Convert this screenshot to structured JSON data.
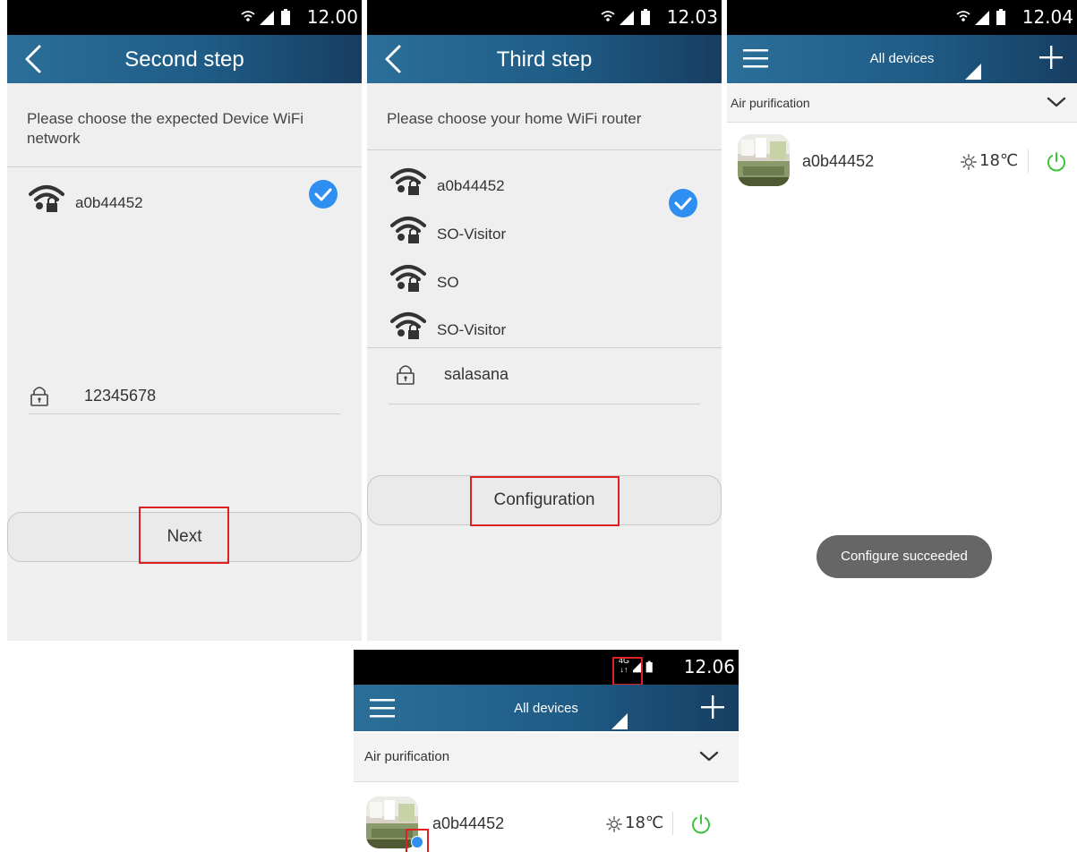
{
  "screens": {
    "second": {
      "status_time": "12.00",
      "title": "Second step",
      "prompt": "Please choose the expected Device WiFi network",
      "networks": [
        {
          "name": "a0b44452",
          "selected": true
        }
      ],
      "password_value": "12345678",
      "next_label": "Next"
    },
    "third": {
      "status_time": "12.03",
      "title": "Third step",
      "prompt": "Please choose your home WiFi router",
      "networks": [
        {
          "name": "a0b44452",
          "selected": false
        },
        {
          "name": "SO-Visitor",
          "selected": true
        },
        {
          "name": "SO",
          "selected": false
        },
        {
          "name": "SO-Visitor",
          "selected": false
        }
      ],
      "password_value": "salasana",
      "config_label": "Configuration"
    },
    "devices1": {
      "status_time": "12.04",
      "title": "All devices",
      "category": "Air purification",
      "device_name": "a0b44452",
      "device_temp": "18℃",
      "toast": "Configure succeeded"
    },
    "devices2": {
      "status_time": "12.06",
      "title": "All devices",
      "category": "Air purification",
      "device_name": "a0b44452",
      "device_temp": "18℃",
      "network_badge": "4G"
    }
  },
  "icons": {
    "back": "chevron-left-icon",
    "wifi": "wifi-lock-icon",
    "check": "check-circle-icon",
    "lock": "lock-icon",
    "menu": "menu-icon",
    "plus": "plus-icon",
    "power": "power-icon",
    "chevron": "chevron-down-icon",
    "sun": "sun-icon"
  },
  "colors": {
    "header": "#1f5c86",
    "check": "#2f8ff0",
    "power": "#3cc43c",
    "highlight": "#e02020",
    "toast": "#666666"
  }
}
